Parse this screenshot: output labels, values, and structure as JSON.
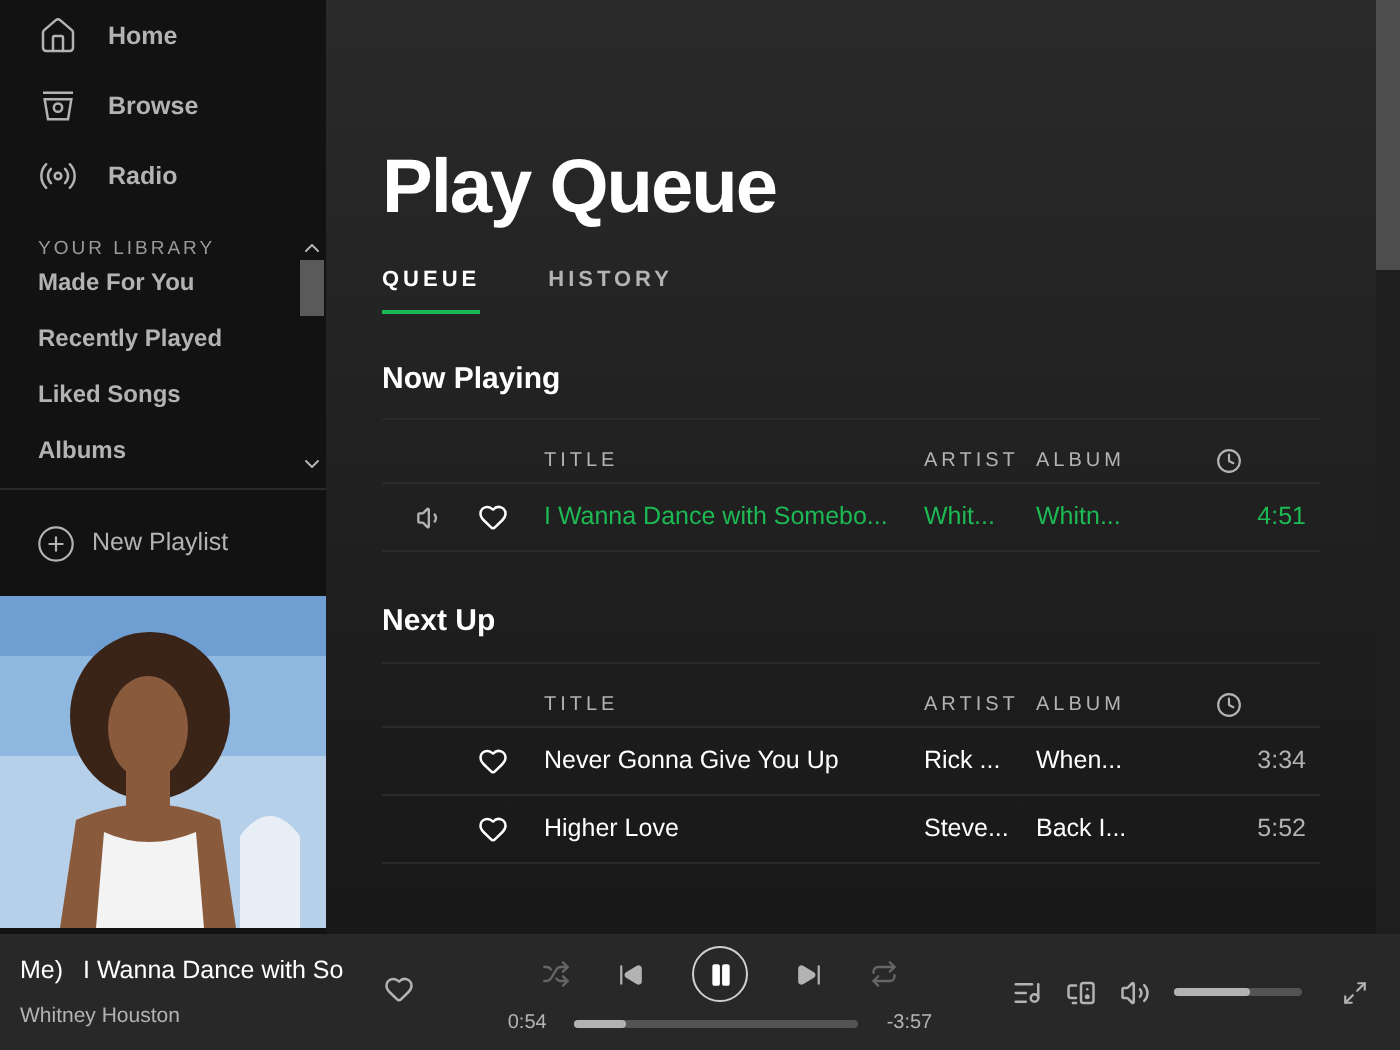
{
  "sidebar": {
    "nav": [
      {
        "label": "Home",
        "kind": "home"
      },
      {
        "label": "Browse",
        "kind": "browse"
      },
      {
        "label": "Radio",
        "kind": "radio"
      }
    ],
    "library_heading": "YOUR LIBRARY",
    "library": [
      "Made For You",
      "Recently Played",
      "Liked Songs",
      "Albums"
    ],
    "new_playlist": "New Playlist"
  },
  "page": {
    "title": "Play Queue",
    "tabs": [
      {
        "label": "QUEUE",
        "selected": true
      },
      {
        "label": "HISTORY",
        "selected": false
      }
    ],
    "sections": [
      {
        "heading": "Now Playing",
        "columns": [
          "TITLE",
          "ARTIST",
          "ALBUM"
        ],
        "rows": [
          {
            "playing": true,
            "title": "I Wanna Dance with Somebo...",
            "artist": "Whit...",
            "album": "Whitn...",
            "duration": "4:51"
          }
        ]
      },
      {
        "heading": "Next Up",
        "columns": [
          "TITLE",
          "ARTIST",
          "ALBUM"
        ],
        "rows": [
          {
            "playing": false,
            "title": "Never Gonna Give You Up",
            "artist": "Rick ...",
            "album": "When...",
            "duration": "3:34"
          },
          {
            "playing": false,
            "title": "Higher Love",
            "artist": "Steve...",
            "album": "Back I...",
            "duration": "5:52"
          }
        ]
      }
    ]
  },
  "player": {
    "title_tail": "Me)",
    "title": "I Wanna Dance with So",
    "artist": "Whitney Houston",
    "elapsed": "0:54",
    "remaining": "-3:57",
    "progress": {
      "level": 0.18
    },
    "volume": {
      "level": 0.6
    }
  }
}
